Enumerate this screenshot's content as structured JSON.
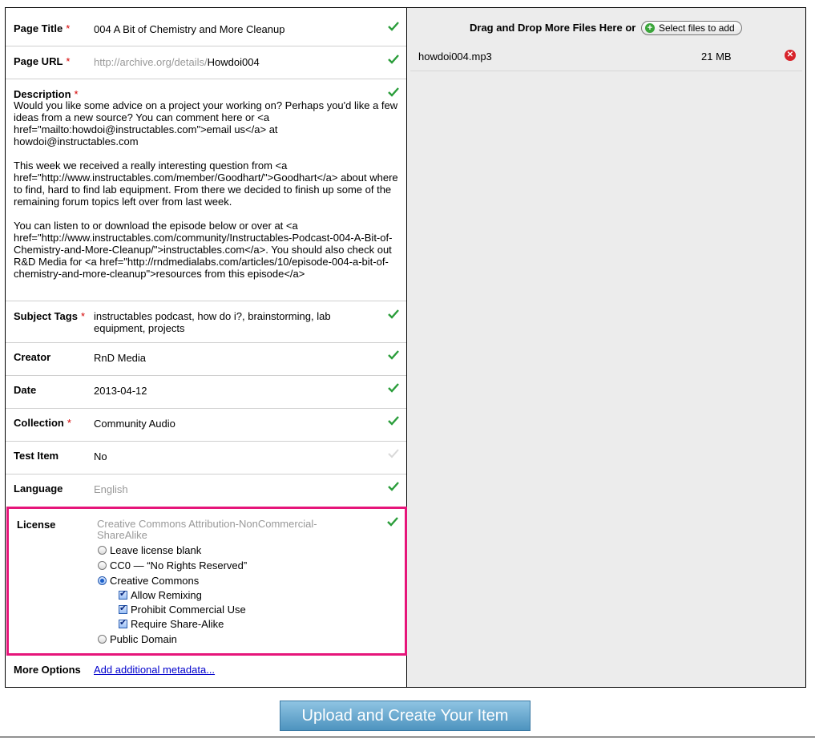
{
  "form": {
    "page_title": {
      "label": "Page Title",
      "req": "*",
      "value": "004 A Bit of Chemistry and More Cleanup"
    },
    "page_url": {
      "label": "Page URL",
      "req": "*",
      "prefix": "http://archive.org/details/",
      "value": "Howdoi004"
    },
    "description": {
      "label": "Description",
      "req": "*",
      "value": "Would you like some advice on a project your working on? Perhaps you'd like a few ideas from a new source? You can comment here or <a href=\"mailto:howdoi@instructables.com\">email us</a> at howdoi@instructables.com\n\nThis week we received a really interesting question from <a href=\"http://www.instructables.com/member/Goodhart/\">Goodhart</a> about where to find, hard to find lab equipment. From there we decided to finish up some of the remaining forum topics left over from last week.\n\nYou can listen to or download the episode below or over at <a href=\"http://www.instructables.com/community/Instructables-Podcast-004-A-Bit-of-Chemistry-and-More-Cleanup/\">instructables.com</a>. You should also check out R&D Media for <a href=\"http://rndmedialabs.com/articles/10/episode-004-a-bit-of-chemistry-and-more-cleanup\">resources from this episode</a>"
    },
    "subject_tags": {
      "label": "Subject Tags",
      "req": "*",
      "value": "instructables podcast, how do i?, brainstorming, lab equipment, projects"
    },
    "creator": {
      "label": "Creator",
      "value": "RnD Media"
    },
    "date": {
      "label": "Date",
      "value": "2013-04-12"
    },
    "collection": {
      "label": "Collection",
      "req": "*",
      "value": "Community Audio"
    },
    "test_item": {
      "label": "Test Item",
      "value": "No"
    },
    "language": {
      "label": "Language",
      "value": "English"
    },
    "license": {
      "label": "License",
      "value": "Creative Commons Attribution-NonCommercial-ShareAlike",
      "options": {
        "blank": "Leave license blank",
        "cc0": "CC0 — “No Rights Reserved”",
        "cc": "Creative Commons",
        "remix": "Allow Remixing",
        "noncommercial": "Prohibit Commercial Use",
        "sharealike": "Require Share-Alike",
        "public": "Public Domain"
      }
    },
    "more_options": {
      "label": "More Options",
      "link": "Add additional metadata..."
    }
  },
  "dropzone": {
    "title": "Drag and Drop More Files Here or",
    "select_button": "Select files to add",
    "files": [
      {
        "name": "howdoi004.mp3",
        "size": "21 MB"
      }
    ]
  },
  "upload_button": "Upload and Create Your Item",
  "colors": {
    "check": "#2a9d3a",
    "check_faint": "#d8d8d8",
    "highlight": "#e6157a",
    "required": "#d40000"
  }
}
